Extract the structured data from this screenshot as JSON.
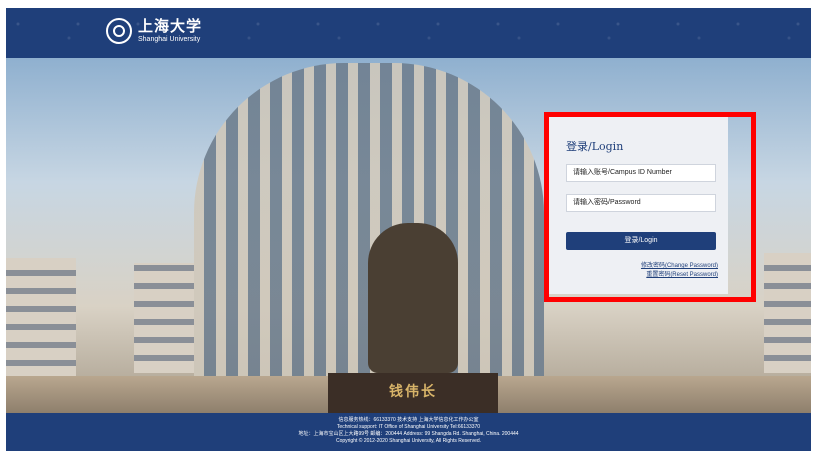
{
  "header": {
    "logo_cn": "上海大学",
    "logo_en": "Shanghai University"
  },
  "scene": {
    "pedestal_text": "钱伟长"
  },
  "login": {
    "title": "登录/Login",
    "id_placeholder": "请输入账号/Campus ID Number",
    "password_placeholder": "请输入密码/Password",
    "login_button": "登录/Login",
    "change_password": "修改密码(Change Password)",
    "reset_password": "重置密码(Reset Password)"
  },
  "footer": {
    "line1": "信息服务热线：66133370 技术支持 上海大学信息化工作办公室",
    "line2": "Technical support: IT Office of Shanghai University Tel:66133370",
    "line3": "地址：上海市宝山区上大路99号 邮编：200444 Address: 99 Shangda Rd. Shanghai, China. 200444",
    "line4": "Copyright © 2012-2020 Shanghai University, All Rights Reserved."
  },
  "colors": {
    "brand_blue": "#1f3f7a",
    "highlight_red": "#ff0000"
  }
}
